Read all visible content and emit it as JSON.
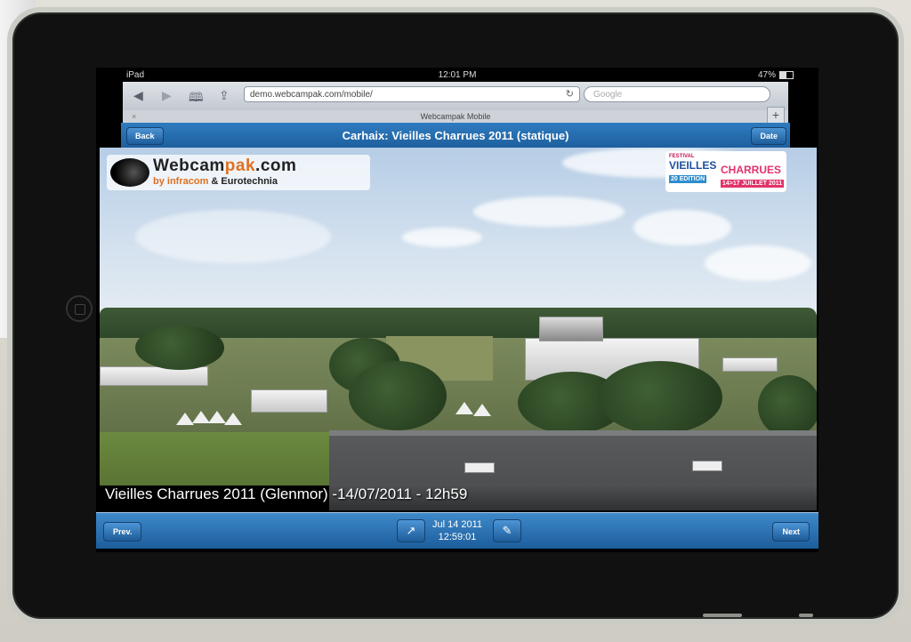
{
  "status_bar": {
    "device": "iPad",
    "time": "12:01 PM",
    "battery": "47%",
    "battery_level": 0.47
  },
  "browser": {
    "url": "demo.webcampak.com/mobile/",
    "search_placeholder": "Google",
    "tab_title": "Webcampak Mobile"
  },
  "header": {
    "back_label": "Back",
    "title": "Carhaix: Vieilles Charrues 2011 (statique)",
    "date_label": "Date"
  },
  "webcam": {
    "logo_text_a": "Webcam",
    "logo_text_b": "pak",
    "logo_text_c": ".com",
    "logo_sub_a": "by infracom",
    "logo_sub_b": " & Eurotechnia",
    "festival": {
      "small": "FESTIVAL",
      "name_a": "VIEILLES",
      "name_b": "CHARRUES",
      "edition": "20 EDITION",
      "dates": "14>17 JUILLET 2011"
    },
    "caption": "Vieilles Charrues 2011 (Glenmor) -14/07/2011 - 12h59"
  },
  "footer": {
    "prev_label": "Prev.",
    "next_label": "Next",
    "date": "Jul 14 2011",
    "time": "12:59:01"
  }
}
